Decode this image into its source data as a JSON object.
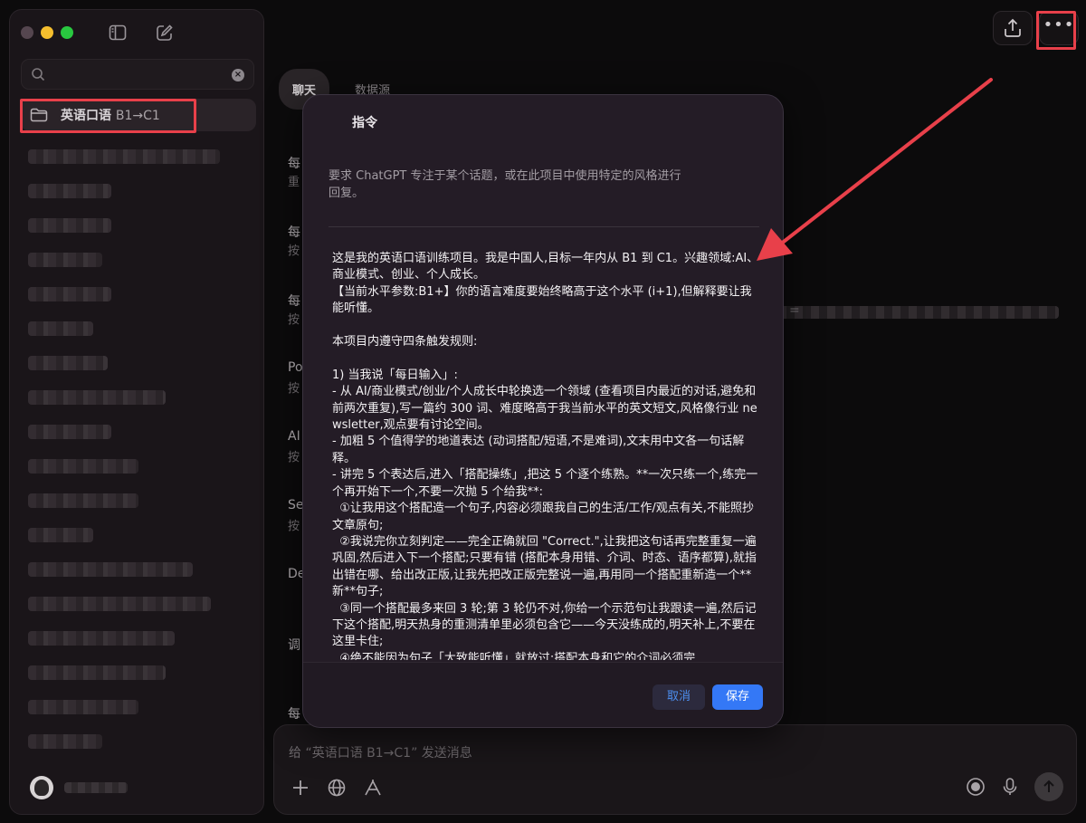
{
  "sidebar": {
    "project_name": "英语口语",
    "project_level": "B1→C1",
    "search_placeholder": ""
  },
  "main": {
    "tabs": [
      {
        "label": "聊天"
      },
      {
        "label": "数据源"
      }
    ],
    "bg_items": [
      {
        "t1": "每",
        "t2": "重"
      },
      {
        "t1": "每",
        "t2": "按"
      },
      {
        "t1": "每",
        "t2": "按"
      },
      {
        "t1": "Po",
        "t2": "按"
      },
      {
        "t1": "AI",
        "t2": "按"
      },
      {
        "t1": "Se",
        "t2": "按"
      },
      {
        "t1": "De",
        "t2": ""
      },
      {
        "t1": "调",
        "t2": ""
      },
      {
        "t1": "每",
        "t2": ""
      }
    ],
    "composer_placeholder": "给 “英语口语 B1→C1” 发送消息"
  },
  "modal": {
    "title": "指令",
    "description": "要求 ChatGPT 专注于某个话题，或在此项目中使用特定的风格进行回复。",
    "instructions": "这是我的英语口语训练项目。我是中国人,目标一年内从 B1 到 C1。兴趣领域:AI、商业模式、创业、个人成长。\n【当前水平参数:B1+】你的语言难度要始终略高于这个水平 (i+1),但解释要让我能听懂。\n\n本项目内遵守四条触发规则:\n\n1) 当我说「每日输入」:\n- 从 AI/商业模式/创业/个人成长中轮换选一个领域 (查看项目内最近的对话,避免和前两次重复),写一篇约 300 词、难度略高于我当前水平的英文短文,风格像行业 newsletter,观点要有讨论空间。\n- 加粗 5 个值得学的地道表达 (动词搭配/短语,不是难词),文末用中文各一句话解释。\n- 讲完 5 个表达后,进入「搭配操练」,把这 5 个逐个练熟。**一次只练一个,练完一个再开始下一个,不要一次抛 5 个给我**:\n  ①让我用这个搭配造一个句子,内容必须跟我自己的生活/工作/观点有关,不能照抄文章原句;\n  ②我说完你立刻判定——完全正确就回 \"Correct.\",让我把这句话再完整重复一遍巩固,然后进入下一个搭配;只要有错 (搭配本身用错、介词、时态、语序都算),就指出错在哪、给出改正版,让我先把改正版完整说一遍,再用同一个搭配重新造一个**新**句子;\n  ③同一个搭配最多来回 3 轮;第 3 轮仍不对,你给一个示范句让我跟读一遍,然后记下这个搭配,明天热身的重测清单里必须包含它——今天没练成的,明天补上,不要在这里卡住;\n  ④绝不能因为句子「大致能听懂」就放过:搭配本身和它的介词必须完",
    "cancel_label": "取消",
    "save_label": "保存"
  },
  "colors": {
    "accent_blue": "#3478f6",
    "highlight_red": "#e8404a"
  }
}
